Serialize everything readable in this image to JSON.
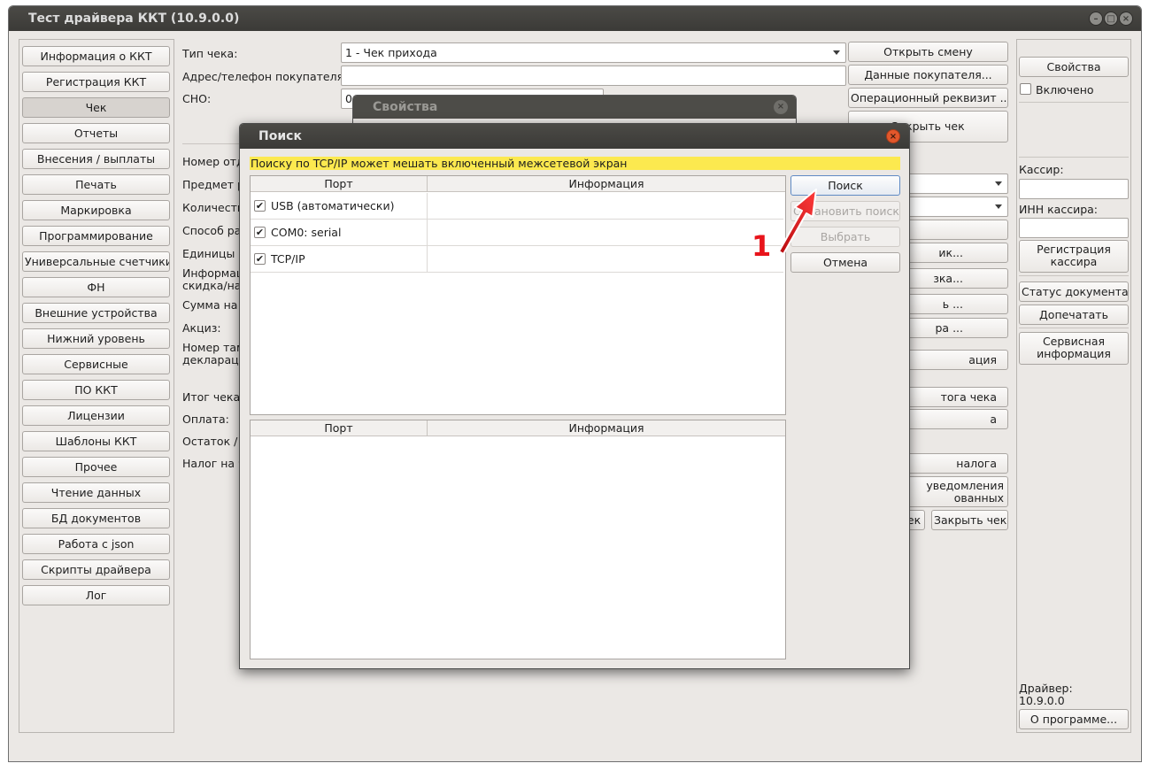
{
  "window": {
    "title": "Тест драйвера ККТ (10.9.0.0)"
  },
  "sidebar": {
    "items": [
      "Информация о ККТ",
      "Регистрация ККТ",
      "Чек",
      "Отчеты",
      "Внесения / выплаты",
      "Печать",
      "Маркировка",
      "Программирование",
      "Универсальные счетчики",
      "ФН",
      "Внешние устройства",
      "Нижний уровень",
      "Сервисные",
      "ПО ККТ",
      "Лицензии",
      "Шаблоны ККТ",
      "Прочее",
      "Чтение данных",
      "БД документов",
      "Работа с json",
      "Скрипты драйвера",
      "Лог"
    ],
    "active_index": 2
  },
  "form": {
    "check_type_label": "Тип чека:",
    "check_type_value": "1 - Чек прихода",
    "buyer_label": "Адрес/телефон покупателя:",
    "sno_label": "СНО:",
    "sno_value": "0",
    "labels": [
      "Номер отд",
      "Предмет р",
      "Количеств",
      "Способ ра",
      "Единицы и",
      "Информац",
      "скидка/на",
      "Сумма на",
      "Акциз:",
      "Номер там",
      "декларац",
      "Итог чека,",
      "Оплата:",
      "Остаток / С",
      "Налог на ч"
    ]
  },
  "right_buttons": {
    "open_shift": "Открыть смену",
    "buyer_data": "Данные покупателя...",
    "op_req": "Операционный реквизит ...",
    "close_check_top": "Закрыть чек",
    "partial": [
      "ик...",
      "зка...",
      "ь ...",
      "ра ...",
      "ация",
      "тога чека",
      "а",
      "налога"
    ],
    "notify": "уведомления\nованных товаров",
    "ek": "ек",
    "close_check": "Закрыть чек"
  },
  "right_panel": {
    "properties": "Свойства",
    "enabled": "Включено",
    "cashier_label": "Кассир:",
    "cashier_inn_label": "ИНН кассира:",
    "register_cashier": "Регистрация кассира",
    "doc_status": "Статус документа",
    "reprint": "Допечатать",
    "service_info": "Сервисная информация",
    "driver_label": "Драйвер:",
    "driver_version": "10.9.0.0",
    "about": "О программе..."
  },
  "props_dialog": {
    "title": "Свойства"
  },
  "search_dialog": {
    "title": "Поиск",
    "warning": "Поиску по TCP/IP может мешать включенный межсетевой экран",
    "col_port": "Порт",
    "col_info": "Информация",
    "ports": [
      {
        "label": "USB (автоматически)",
        "checked": true
      },
      {
        "label": "COM0: serial",
        "checked": true
      },
      {
        "label": "TCP/IP",
        "checked": true
      }
    ],
    "btn_search": "Поиск",
    "btn_stop": "Остановить поиск",
    "btn_select": "Выбрать",
    "btn_cancel": "Отмена"
  },
  "annotation": {
    "number": "1",
    "arrow_color": "#e8141b"
  },
  "icons": {
    "check": "✔",
    "close": "×",
    "minimize": "–",
    "maximize": "□"
  }
}
